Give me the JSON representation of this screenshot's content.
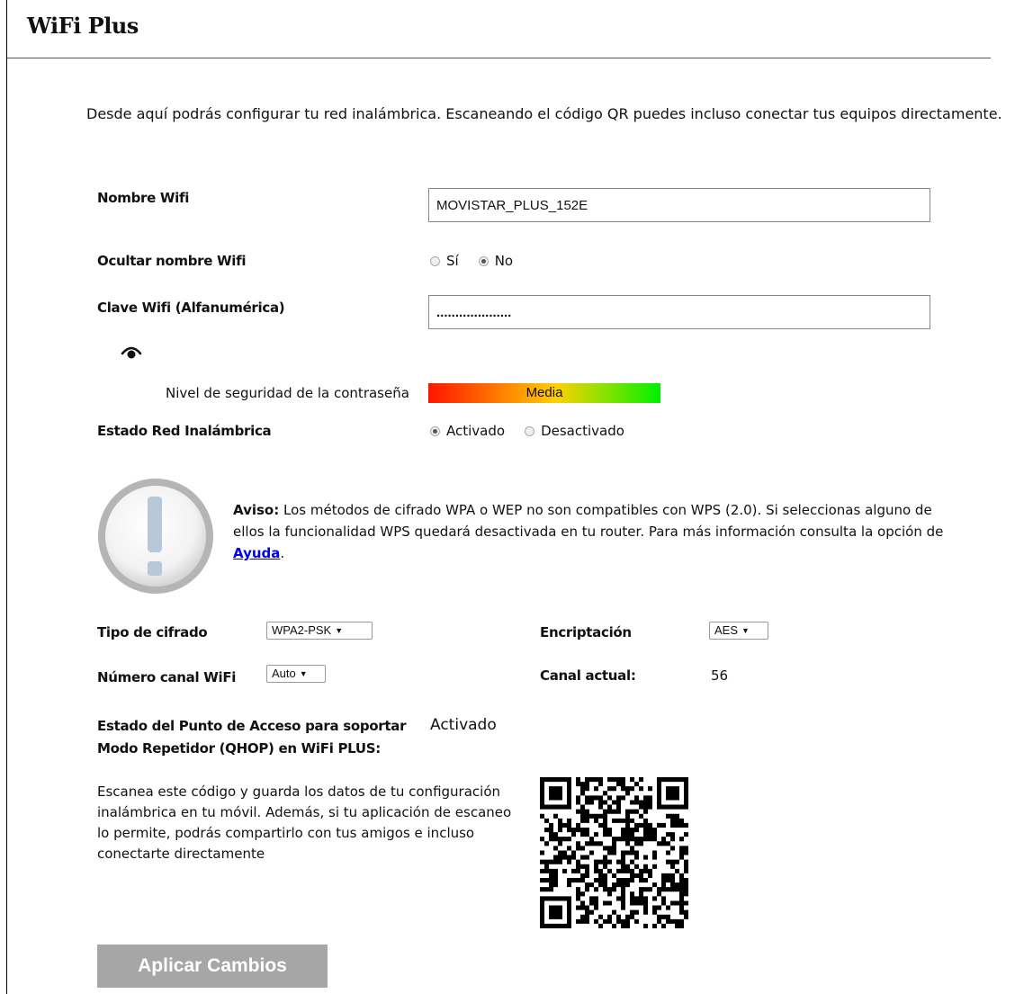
{
  "header": {
    "title": "WiFi Plus"
  },
  "intro": "Desde aquí podrás configurar tu red inalámbrica. Escaneando el código QR puedes incluso conectar tus equipos directamente.",
  "wifi_name": {
    "label": "Nombre Wifi",
    "value": "MOVISTAR_PLUS_152E"
  },
  "hide_name": {
    "label": "Ocultar nombre Wifi",
    "options": [
      "Sí",
      "No"
    ],
    "selected": "No"
  },
  "wifi_key": {
    "label": "Clave Wifi (Alfanumérica)",
    "value": "....................",
    "show_icon": "eye-icon"
  },
  "password_strength": {
    "label": "Nivel de seguridad de la contraseña",
    "value": "Media"
  },
  "wireless_state": {
    "label": "Estado Red Inalámbrica",
    "options": [
      "Activado",
      "Desactivado"
    ],
    "selected": "Activado"
  },
  "notice": {
    "icon": "warning-exclamation-icon",
    "bold": "Aviso:",
    "text": " Los métodos de cifrado WPA o WEP no son compatibles con WPS (2.0). Si seleccionas alguno de ellos la funcionalidad WPS quedará desactivada en tu router. Para más información consulta la opción de ",
    "link": "Ayuda",
    "end": "."
  },
  "cipher_type": {
    "label": "Tipo de cifrado",
    "value": "WPA2-PSK"
  },
  "encryption": {
    "label": "Encriptación",
    "value": "AES"
  },
  "channel": {
    "label": "Número canal WiFi",
    "value": "Auto"
  },
  "current_channel": {
    "label": "Canal actual:",
    "value": "56"
  },
  "access_point": {
    "label_line1": "Estado del Punto de Acceso para soportar",
    "label_line2": "Modo Repetidor (QHOP) en WiFi PLUS:",
    "value": "Activado"
  },
  "qr": {
    "text": "Escanea este código y guarda los datos de tu configuración inalámbrica en tu móvil. Además, si tu aplicación de escaneo lo permite, podrás compartirlo con tus amigos e incluso conectarte directamente",
    "icon": "qr-code-icon"
  },
  "apply_button": "Aplicar Cambios"
}
